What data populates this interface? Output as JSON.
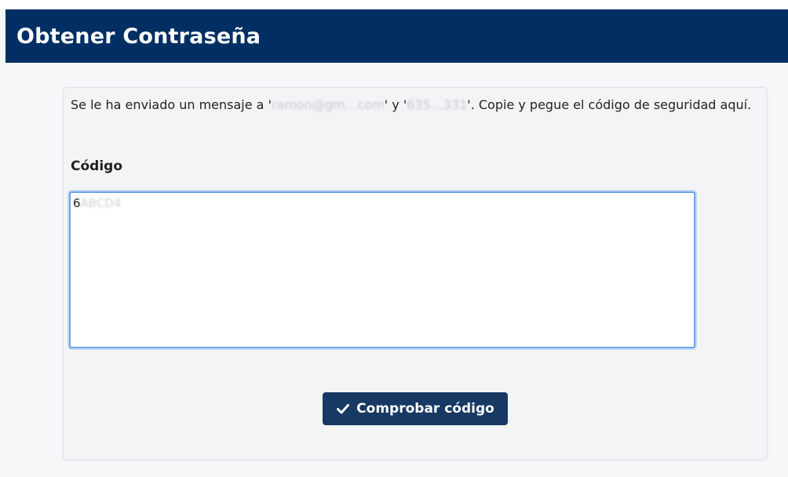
{
  "header": {
    "title": "Obtener Contraseña"
  },
  "message": {
    "prefix": "Se le ha enviado un mensaje a '",
    "email_redacted": "ramon@gm…com",
    "middle": "' y '",
    "phone_redacted": "635…331",
    "suffix": "'. Copie y pegue el código de seguridad aquí."
  },
  "code_field": {
    "label": "Código",
    "value_visible": "6",
    "value_redacted": "ABCD4"
  },
  "submit_button": {
    "label": "Comprobar código",
    "icon": "check-icon"
  },
  "colors": {
    "header_bg": "#012f63",
    "button_bg": "#173963",
    "focus_border": "#6fa2ea"
  }
}
